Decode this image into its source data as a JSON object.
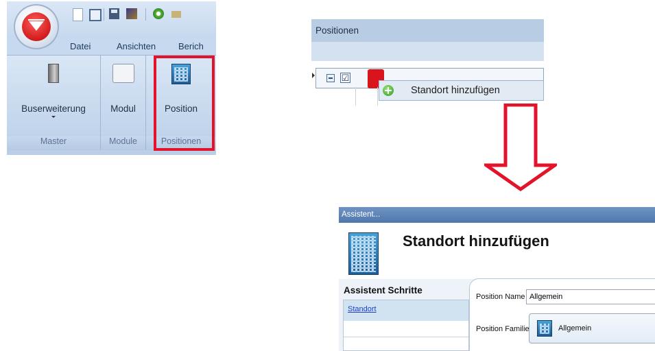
{
  "ribbon": {
    "menu": [
      "Datei",
      "Ansichten",
      "Berich"
    ],
    "groups": [
      {
        "label": "Master",
        "buttons": [
          "Buserweiterung"
        ]
      },
      {
        "label": "Module",
        "buttons": [
          "Modul"
        ]
      },
      {
        "label": "Positionen",
        "buttons": [
          "Position"
        ]
      }
    ],
    "highlight_color": "#e3132b",
    "orb_icon": "application-orb-icon"
  },
  "positionen_panel": {
    "title": "Positionen",
    "row": {
      "checkbox": "☑",
      "icon": "red-device-icon"
    },
    "context_menu": {
      "item": "Standort hinzufügen",
      "icon": "add-green-icon"
    }
  },
  "arrow": {
    "color": "#e3132b",
    "direction": "down"
  },
  "wizard": {
    "window_title": "Assistent...",
    "header_title": "Standort hinzufügen",
    "header_icon": "building-icon",
    "steps_title": "Assistent Schritte",
    "steps": [
      "Standort"
    ],
    "form": {
      "name_label": "Position Name",
      "name_value": "Allgemein",
      "family_label": "Position Familie",
      "family_value": "Allgemein"
    }
  }
}
